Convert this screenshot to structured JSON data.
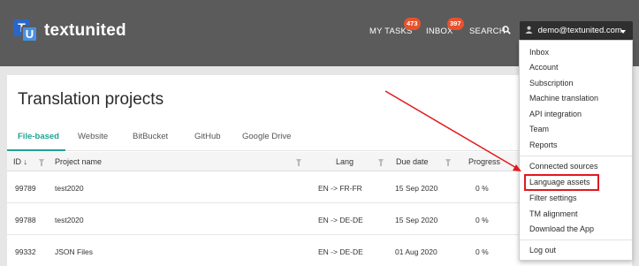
{
  "brand": {
    "logo_letters": [
      "T",
      "U"
    ],
    "name": "textunited",
    "accent": "#1fa396",
    "badge_color": "#e8522e"
  },
  "header": {
    "my_tasks_label": "MY TASKS",
    "my_tasks_count": "473",
    "inbox_label": "INBOX",
    "inbox_count": "397",
    "search_label": "SEARCH",
    "user_email": "demo@textunited.com"
  },
  "main": {
    "title": "Translation projects",
    "tabs": [
      {
        "label": "File-based",
        "active": true
      },
      {
        "label": "Website",
        "active": false
      },
      {
        "label": "BitBucket",
        "active": false
      },
      {
        "label": "GitHub",
        "active": false
      },
      {
        "label": "Google Drive",
        "active": false
      }
    ],
    "table": {
      "columns": [
        "ID",
        "Project name",
        "Lang",
        "Due date",
        "Progress"
      ],
      "sort_indicator": "↓",
      "rows": [
        {
          "id": "99789",
          "name": "test2020",
          "lang": "EN -> FR-FR",
          "due": "15 Sep 2020",
          "progress": "0 %"
        },
        {
          "id": "99788",
          "name": "test2020",
          "lang": "EN -> DE-DE",
          "due": "15 Sep 2020",
          "progress": "0 %"
        },
        {
          "id": "99332",
          "name": "JSON Files",
          "lang": "EN -> DE-DE",
          "due": "01 Aug 2020",
          "progress": "0 %"
        }
      ]
    }
  },
  "user_menu": {
    "group1": [
      "Inbox",
      "Account",
      "Subscription",
      "Machine translation",
      "API integration",
      "Team",
      "Reports"
    ],
    "group2": [
      "Connected sources",
      "Language assets",
      "Filter settings",
      "TM alignment",
      "Download the App"
    ],
    "group3": [
      "Log out"
    ],
    "highlighted_item": "Language assets",
    "highlight_color": "#e0191f"
  }
}
